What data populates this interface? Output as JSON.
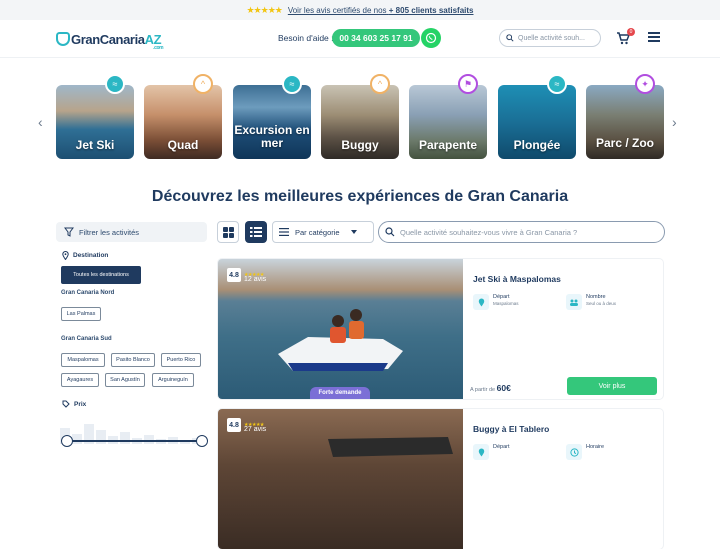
{
  "topbar": {
    "stars": "★★★★★",
    "link_text": "Voir les avis certifiés de nos",
    "count": "+ 805 clients satisfaits"
  },
  "header": {
    "logo_main": "GranCanaria",
    "logo_accent": "AZ",
    "logo_com": ".com",
    "help_label": "Besoin d'aide :",
    "phone": "00 34 603 25 17 91",
    "search_placeholder": "Quelle activité souh...",
    "cart_count": "0"
  },
  "categories": [
    {
      "label": "Jet Ski",
      "icon": "waves-icon",
      "color": "#2bb7c4"
    },
    {
      "label": "Quad",
      "icon": "mountain-icon",
      "color": "#f0b266"
    },
    {
      "label": "Excursion en mer",
      "icon": "waves-icon",
      "color": "#2bb7c4"
    },
    {
      "label": "Buggy",
      "icon": "mountain-icon",
      "color": "#f0b266"
    },
    {
      "label": "Parapente",
      "icon": "flag-icon",
      "color": "#b14ee0"
    },
    {
      "label": "Plongée",
      "icon": "waves-icon",
      "color": "#2bb7c4"
    },
    {
      "label": "Parc / Zoo",
      "icon": "party-icon",
      "color": "#b14ee0"
    }
  ],
  "main_title": "Découvrez les meilleures expériences de Gran Canaria",
  "filters": {
    "head": "Filtrer les activités",
    "destination_label": "Destination",
    "all_destinations": "Toutes les destinations",
    "nord_label": "Gran Canaria Nord",
    "nord_items": [
      "Las Palmas"
    ],
    "sud_label": "Gran Canaria Sud",
    "sud_items": [
      "Maspalomas",
      "Pasito Blanco",
      "Puerto Rico",
      "Ayagaures",
      "San Agustín",
      "Arguineguín"
    ],
    "price_label": "Prix"
  },
  "toolbar": {
    "category_select": "Par catégorie",
    "search_placeholder": "Quelle activité souhaitez-vous vivre à Gran Canaria ?"
  },
  "activities": [
    {
      "rating": "4.8",
      "reviews": "12 avis",
      "badge": "Forte demande",
      "title": "Jet Ski à Maspalomas",
      "depart_label": "Départ",
      "depart_value": "Maspalomas",
      "nombre_label": "Nombre",
      "nombre_value": "Seul ou à deux",
      "price_prefix": "A partir de",
      "price": "60€",
      "cta": "Voir plus"
    },
    {
      "rating": "4.8",
      "reviews": "27 avis",
      "title": "Buggy à El Tablero",
      "depart_label": "Départ",
      "nombre_label": "Horaire"
    }
  ]
}
